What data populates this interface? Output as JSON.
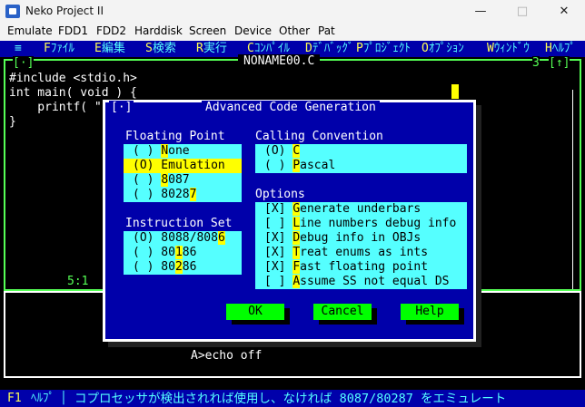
{
  "window": {
    "title": "Neko Project II",
    "minimize": "—",
    "maximize": "□",
    "close": "✕"
  },
  "menubar": [
    "Emulate",
    "FDD1",
    "FDD2",
    "Harddisk",
    "Screen",
    "Device",
    "Other",
    "Pat"
  ],
  "ide_menu": {
    "hamburger": "≡",
    "items": [
      {
        "key": "F",
        "label": "ﾌｧｲﾙ"
      },
      {
        "key": "E",
        "label": "編集"
      },
      {
        "key": "S",
        "label": "検索"
      },
      {
        "key": "R",
        "label": "実行"
      },
      {
        "key": "C",
        "label": "ｺﾝﾊﾟｲﾙ"
      },
      {
        "key": "D",
        "label": "ﾃﾞﾊﾞｯｸﾞ"
      },
      {
        "key": "P",
        "label": "ﾌﾟﾛｼﾞｪｸﾄ"
      },
      {
        "key": "O",
        "label": "ｵﾌﾟｼｮﾝ"
      },
      {
        "key": "W",
        "label": "ｳｨﾝﾄﾞｳ"
      },
      {
        "key": "H",
        "label": "ﾍﾙﾌﾟ"
      }
    ]
  },
  "editor": {
    "close_box": "[·]",
    "filename": "NONAME00.C",
    "window_number": "3",
    "zoom_box": "[↑]",
    "lines": [
      "#include <stdio.h>",
      "int main( void ) {",
      "    printf( \"",
      "}"
    ],
    "position": "5:1"
  },
  "dialog": {
    "close_box": "[·]",
    "title": "Advanced Code Generation",
    "floating_point": {
      "label": "Floating Point",
      "options": [
        {
          "mark": "( )",
          "text": "None",
          "hotkey_index": 0,
          "selected": false
        },
        {
          "mark": "(O)",
          "text": "Emulation",
          "hotkey_index": 0,
          "selected": true
        },
        {
          "mark": "( )",
          "text": "8087",
          "hotkey_index": 0,
          "selected": false
        },
        {
          "mark": "( )",
          "text": "80287",
          "hotkey_index": 4,
          "selected": false
        }
      ]
    },
    "instruction_set": {
      "label": "Instruction Set",
      "options": [
        {
          "mark": "(O)",
          "text": "8088/8086",
          "hotkey_index": 8,
          "selected": true
        },
        {
          "mark": "( )",
          "text": "80186",
          "hotkey_index": 2,
          "selected": false
        },
        {
          "mark": "( )",
          "text": "80286",
          "hotkey_index": 2,
          "selected": false
        }
      ]
    },
    "calling_convention": {
      "label": "Calling Convention",
      "options": [
        {
          "mark": "(O)",
          "text": "C",
          "hotkey_index": 0,
          "selected": true
        },
        {
          "mark": "( )",
          "text": "Pascal",
          "hotkey_index": 0,
          "selected": false
        }
      ]
    },
    "options": {
      "label": "Options",
      "items": [
        {
          "mark": "[X]",
          "text": "Generate underbars",
          "hotkey_index": 0
        },
        {
          "mark": "[ ]",
          "text": "Line numbers debug info",
          "hotkey_index": 0
        },
        {
          "mark": "[X]",
          "text": "Debug info in OBJs",
          "hotkey_index": 0
        },
        {
          "mark": "[X]",
          "text": "Treat enums as ints",
          "hotkey_index": 0
        },
        {
          "mark": "[X]",
          "text": "Fast floating point",
          "hotkey_index": 0
        },
        {
          "mark": "[ ]",
          "text": "Assume SS not equal DS",
          "hotkey_index": 0
        }
      ]
    },
    "buttons": {
      "ok": "OK",
      "cancel": "Cancel",
      "help": "Help"
    }
  },
  "console": {
    "line": "A>echo off"
  },
  "statusbar": {
    "f1": "F1",
    "help": "ﾍﾙﾌﾟ",
    "sep": "│",
    "message": "コプロセッサが検出されれば使用し、なければ 8087/80287 をエミュレート"
  }
}
